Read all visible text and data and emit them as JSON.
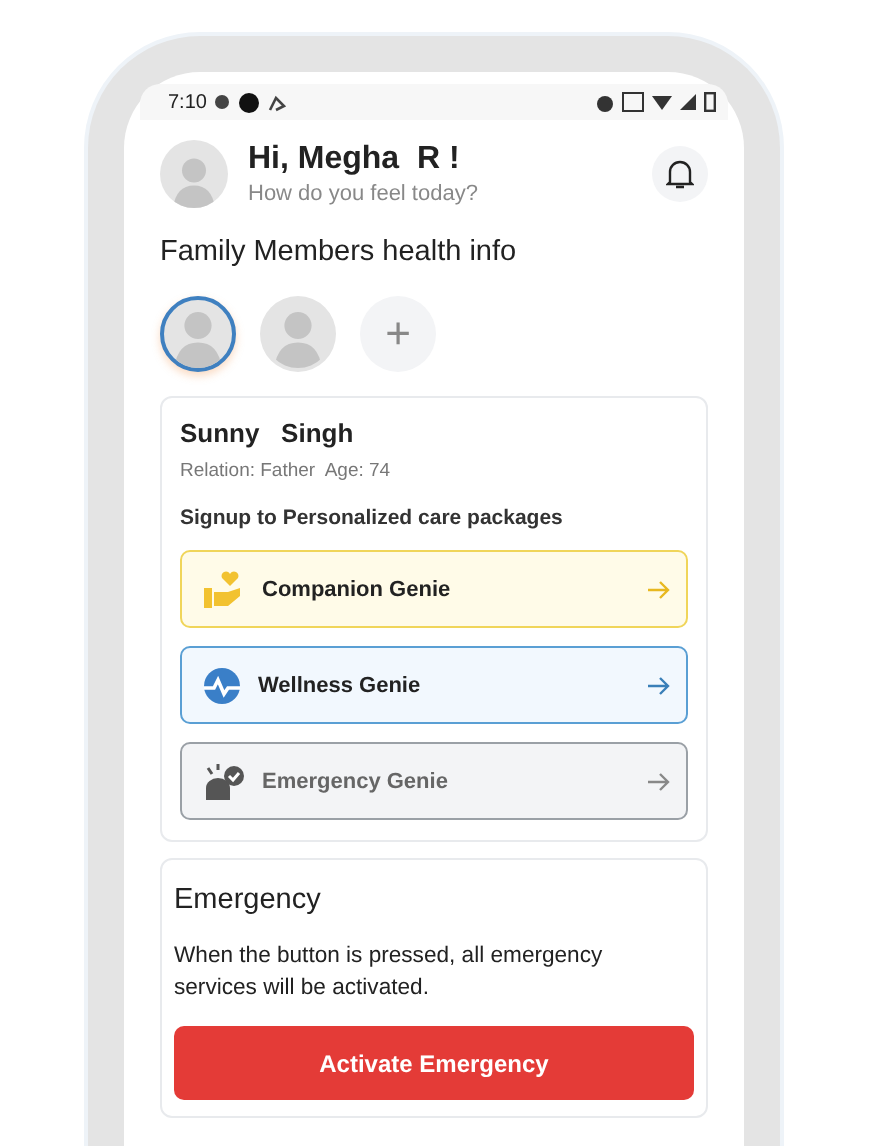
{
  "status_bar": {
    "time": "7:10"
  },
  "header": {
    "greeting": "Hi, Megha  R !",
    "subtitle": "How do you feel today?"
  },
  "section_title": "Family Members health info",
  "members": [
    {
      "selected": true
    },
    {
      "selected": false
    }
  ],
  "add_button": "+",
  "member_card": {
    "name": "Sunny   Singh",
    "details": "Relation: Father  Age: 74",
    "packages_title": "Signup to Personalized care packages",
    "packages": [
      {
        "kind": "companion",
        "label": "Companion Genie"
      },
      {
        "kind": "wellness",
        "label": "Wellness Genie"
      },
      {
        "kind": "emergency",
        "label": "Emergency Genie"
      }
    ]
  },
  "emergency": {
    "title": "Emergency",
    "description": "When the button is pressed, all emergency services will be activated.",
    "button": "Activate Emergency"
  }
}
